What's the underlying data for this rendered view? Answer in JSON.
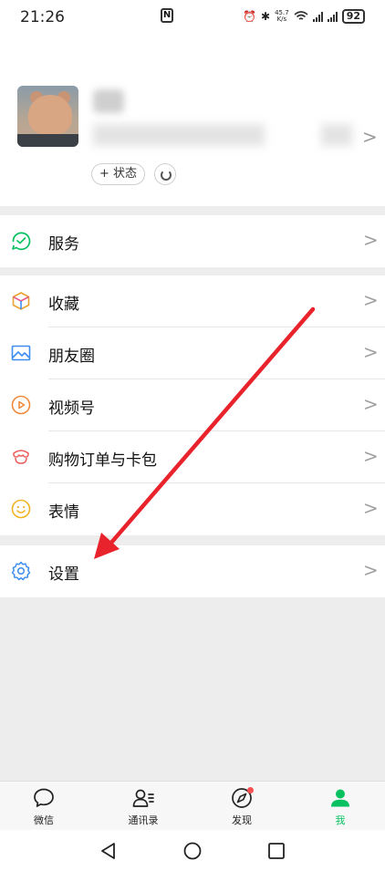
{
  "status_bar": {
    "time": "21:26",
    "nfc": "N",
    "speed_top": "45.7",
    "speed_bottom": "K/s",
    "battery": "92"
  },
  "profile": {
    "status_button": "+ 状态"
  },
  "menu_groups": [
    {
      "items": [
        {
          "label": "服务",
          "icon": "service-icon"
        }
      ]
    },
    {
      "items": [
        {
          "label": "收藏",
          "icon": "favorites-icon"
        },
        {
          "label": "朋友圈",
          "icon": "moments-icon"
        },
        {
          "label": "视频号",
          "icon": "channels-icon"
        },
        {
          "label": "购物订单与卡包",
          "icon": "orders-cards-icon"
        },
        {
          "label": "表情",
          "icon": "stickers-icon"
        }
      ]
    },
    {
      "items": [
        {
          "label": "设置",
          "icon": "settings-icon"
        }
      ]
    }
  ],
  "chevron": ">",
  "bottom_nav": [
    {
      "label": "微信",
      "icon": "chats-icon",
      "active": false
    },
    {
      "label": "通讯录",
      "icon": "contacts-icon",
      "active": false
    },
    {
      "label": "发现",
      "icon": "discover-icon",
      "active": false,
      "badge": true
    },
    {
      "label": "我",
      "icon": "me-icon",
      "active": true
    }
  ],
  "colors": {
    "accent": "#07c160",
    "badge": "#fa5151",
    "annotation_arrow": "#e8232b"
  }
}
